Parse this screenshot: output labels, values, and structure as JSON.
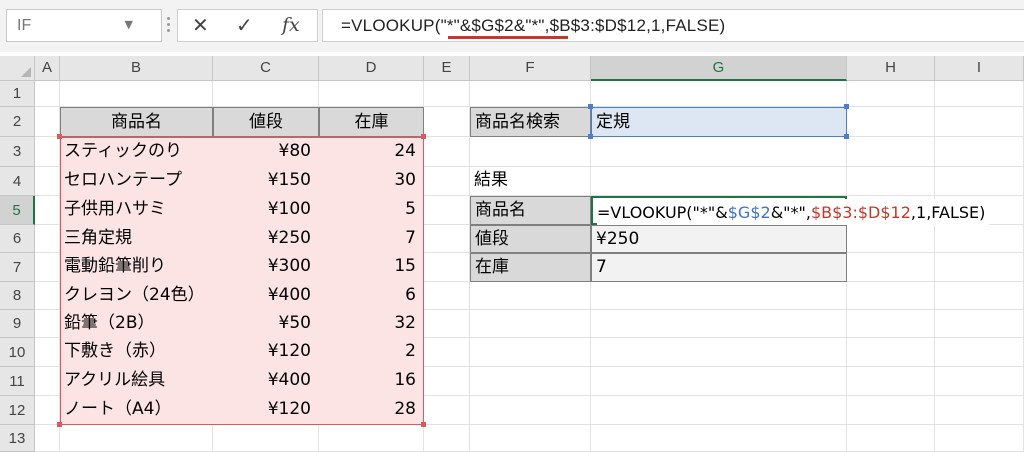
{
  "formula_bar": {
    "name_box": "IF",
    "cancel_icon": "✕",
    "enter_icon": "✓",
    "fx_label": "fx",
    "formula_parts": [
      "=VLOOKUP(",
      "\"*\"",
      "&$G$2&",
      "\"*\"",
      ",$B$3:$D$12,1,FALSE)"
    ]
  },
  "columns": [
    "A",
    "B",
    "C",
    "D",
    "E",
    "F",
    "G",
    "H",
    "I"
  ],
  "rows": [
    "1",
    "2",
    "3",
    "4",
    "5",
    "6",
    "7",
    "8",
    "9",
    "10",
    "11",
    "12",
    "13"
  ],
  "product_table": {
    "headers": [
      "商品名",
      "値段",
      "在庫"
    ],
    "rows": [
      {
        "name": "スティックのり",
        "price": "¥80",
        "stock": "24"
      },
      {
        "name": "セロハンテープ",
        "price": "¥150",
        "stock": "30"
      },
      {
        "name": "子供用ハサミ",
        "price": "¥100",
        "stock": "5"
      },
      {
        "name": "三角定規",
        "price": "¥250",
        "stock": "7"
      },
      {
        "name": "電動鉛筆削り",
        "price": "¥300",
        "stock": "15"
      },
      {
        "name": "クレヨン（24色）",
        "price": "¥400",
        "stock": "6"
      },
      {
        "name": "鉛筆（2B）",
        "price": "¥50",
        "stock": "32"
      },
      {
        "name": "下敷き（赤）",
        "price": "¥120",
        "stock": "2"
      },
      {
        "name": "アクリル絵具",
        "price": "¥400",
        "stock": "16"
      },
      {
        "name": "ノート（A4）",
        "price": "¥120",
        "stock": "28"
      }
    ]
  },
  "search": {
    "label": "商品名検索",
    "value": "定規"
  },
  "result": {
    "title": "結果",
    "name_label": "商品名",
    "price_label": "値段",
    "price_value": "¥250",
    "stock_label": "在庫",
    "stock_value": "7",
    "editing_formula": {
      "p1": "=VLOOKUP(\"*\"&",
      "p2": "$G$2",
      "p3": "&\"*\",",
      "p4": "$B$3:$D$12",
      "p5": ",1,FALSE)"
    }
  },
  "colors": {
    "excel_green": "#217346",
    "reference_blue": "#3f72c5",
    "reference_red": "#c0392b",
    "range_fill": "#fce4e4"
  }
}
